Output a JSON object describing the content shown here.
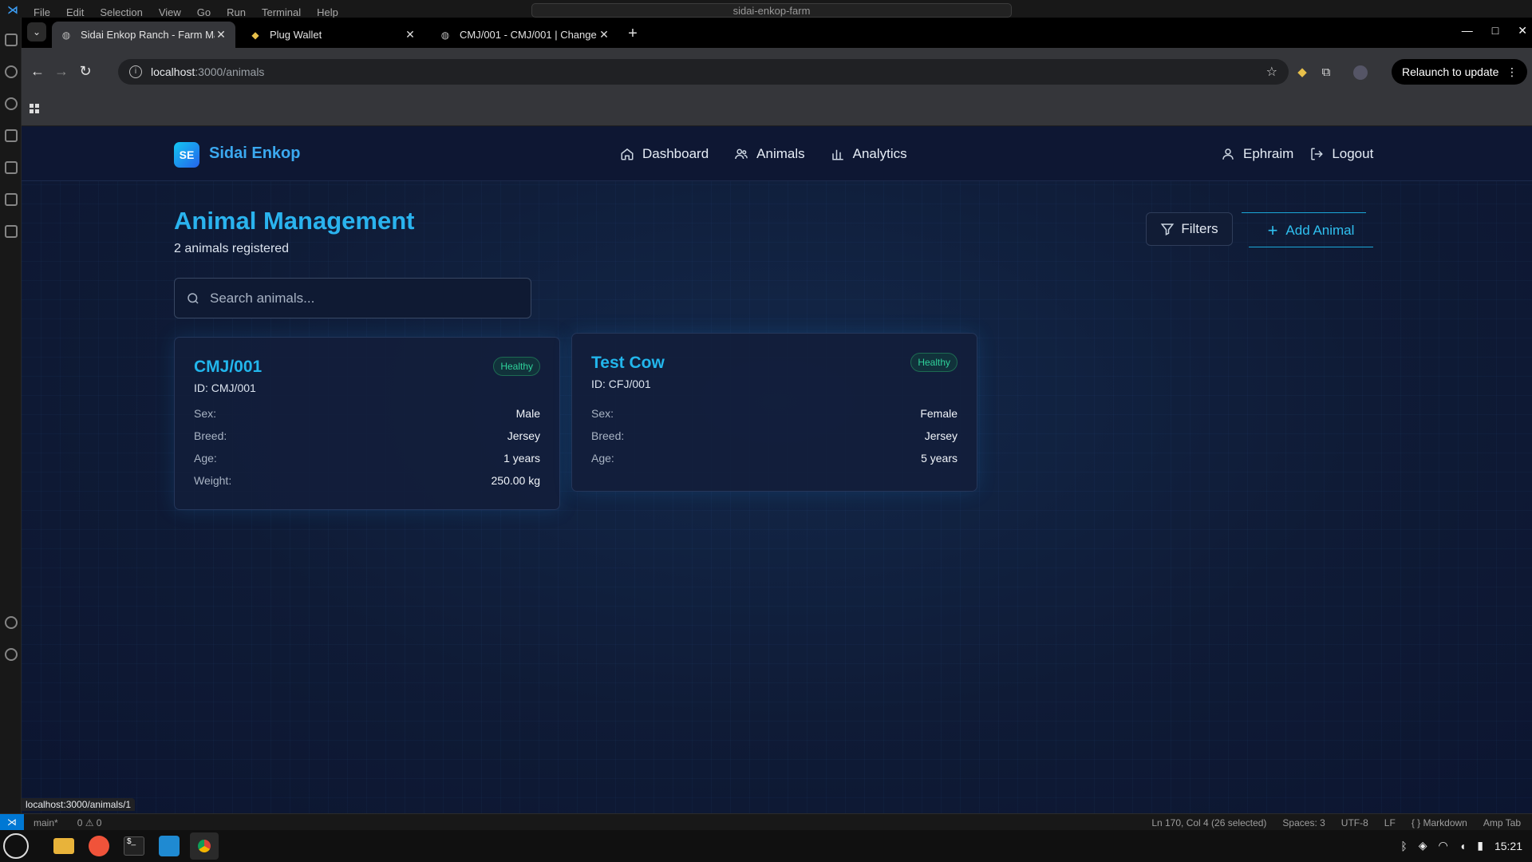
{
  "vscode": {
    "menu": [
      "File",
      "Edit",
      "Selection",
      "View",
      "Go",
      "Run",
      "Terminal",
      "Help"
    ],
    "command_center": "sidai-enkop-farm",
    "status_left": [
      "main*",
      "0 ⚠ 0"
    ],
    "status_right": [
      "Ln 170, Col 4 (26 selected)",
      "Spaces: 3",
      "UTF-8",
      "LF",
      "{ } Markdown",
      "Amp Tab"
    ]
  },
  "browser": {
    "tabs": [
      {
        "title": "Sidai Enkop Ranch - Farm Ma",
        "active": true
      },
      {
        "title": "Plug Wallet",
        "active": false
      },
      {
        "title": "CMJ/001 - CMJ/001 | Change",
        "active": false
      }
    ],
    "url_host": "localhost",
    "url_path": ":3000/animals",
    "relaunch": "Relaunch to update",
    "status_url": "localhost:3000/animals/1"
  },
  "app": {
    "logo_initials": "SE",
    "brand": "Sidai Enkop",
    "nav": [
      "Dashboard",
      "Animals",
      "Analytics"
    ],
    "user": "Ephraim",
    "logout": "Logout"
  },
  "page": {
    "title": "Animal Management",
    "subtitle": "2 animals registered",
    "filters_label": "Filters",
    "add_label": "Add Animal",
    "search_placeholder": "Search animals..."
  },
  "animals": [
    {
      "name": "CMJ/001",
      "id_line": "ID: CMJ/001",
      "status": "Healthy",
      "fields": [
        {
          "k": "Sex:",
          "v": "Male"
        },
        {
          "k": "Breed:",
          "v": "Jersey"
        },
        {
          "k": "Age:",
          "v": "1 years"
        },
        {
          "k": "Weight:",
          "v": "250.00 kg"
        }
      ]
    },
    {
      "name": "Test Cow",
      "id_line": "ID: CFJ/001",
      "status": "Healthy",
      "fields": [
        {
          "k": "Sex:",
          "v": "Female"
        },
        {
          "k": "Breed:",
          "v": "Jersey"
        },
        {
          "k": "Age:",
          "v": "5 years"
        }
      ]
    }
  ],
  "taskbar": {
    "clock": "15:21"
  },
  "colors": {
    "accent": "#22b6ec",
    "healthy": "#2fd19a",
    "page_bg": "#0f1b36"
  }
}
